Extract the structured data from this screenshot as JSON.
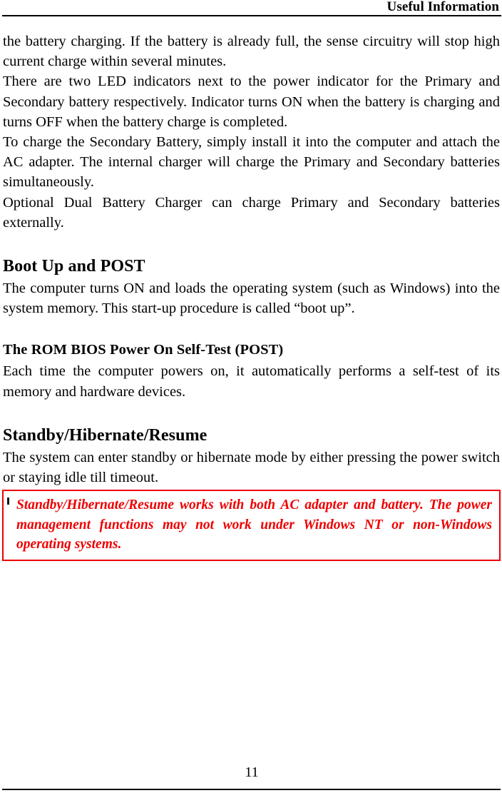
{
  "header": {
    "title": "Useful Information"
  },
  "body": {
    "paragraphs": [
      "the battery charging. If the battery is already full, the sense circuitry will stop high current charge within several minutes.",
      "There are two LED indicators next to the power indicator for the Primary and Secondary battery respectively. Indicator turns ON when the battery is charging and turns OFF when the battery charge is completed.",
      "To charge the Secondary Battery, simply install it into the computer and attach the AC adapter. The internal charger will charge the Primary and Secondary batteries simultaneously.",
      "Optional Dual Battery Charger can charge Primary and Secondary batteries externally."
    ]
  },
  "sections": [
    {
      "heading": "Boot Up and POST",
      "paragraphs": [
        "The computer turns ON and loads the operating system (such as Windows) into the system memory. This start-up procedure is called “boot up”."
      ],
      "subheading": "The ROM BIOS Power On Self-Test (POST)",
      "sub_paragraphs": [
        "Each time the computer powers on, it automatically performs a self-test of its memory and hardware devices."
      ]
    },
    {
      "heading": "Standby/Hibernate/Resume",
      "paragraphs": [
        "The system can enter standby or hibernate mode by either pressing the power switch or staying idle till timeout."
      ]
    }
  ],
  "note": {
    "text": "Standby/Hibernate/Resume works with both AC adapter and battery. The power management functions may not work under Windows NT or non-Windows operating systems.",
    "border_color": "#ee0000",
    "text_color": "#ee0000"
  },
  "footer": {
    "page_number": "11"
  }
}
